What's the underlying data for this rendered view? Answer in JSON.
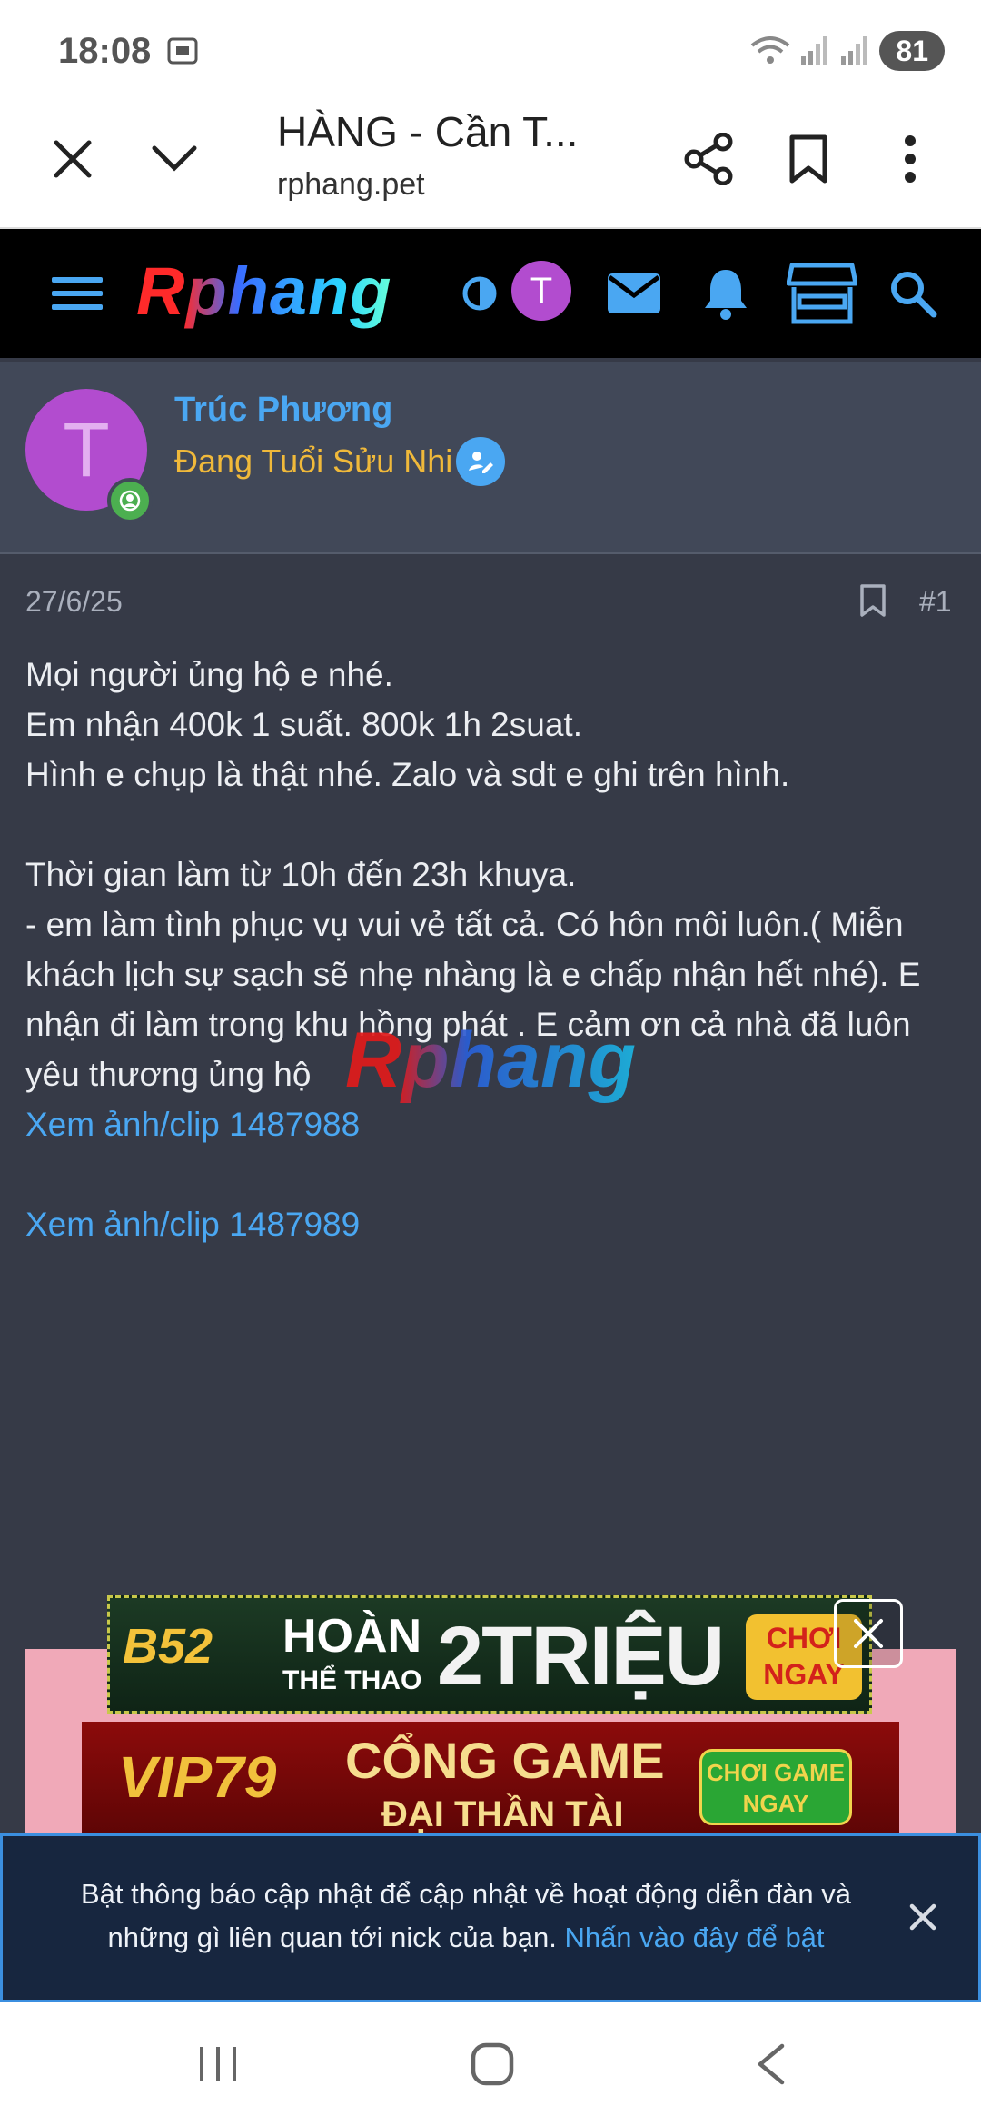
{
  "status_bar": {
    "time": "18:08",
    "battery": "81"
  },
  "browser": {
    "title": "HÀNG - Cần T...",
    "domain": "rphang.pet"
  },
  "site_nav": {
    "logo": "Rphang",
    "avatar_letter": "T"
  },
  "user": {
    "avatar_letter": "T",
    "name": "Trúc Phương",
    "rank": "Đang Tuổi Sửu Nhi"
  },
  "post": {
    "date": "27/6/25",
    "number": "#1",
    "lines": [
      "Mọi người ủng hộ e nhé.",
      "Em nhận 400k 1 suất. 800k 1h 2suat.",
      "Hình e chụp là thật nhé. Zalo và sdt e ghi trên hình.",
      "Thời gian làm từ 10h đến 23h khuya.",
      "- em làm tình phục vụ vui vẻ tất cả. Có hôn môi luôn.( Miễn khách lịch sự sạch sẽ nhẹ nhàng là e chấp nhận hết nhé). E nhận đi làm trong khu hồng phát . E cảm ơn cả nhà đã luôn yêu thương ủng hộ"
    ],
    "link1": "Xem ảnh/clip 1487988",
    "link2": "Xem ảnh/clip 1487989",
    "watermark": "Rphang"
  },
  "ads": {
    "b52": {
      "logo": "B52",
      "line1": "HOÀN",
      "line2": "THỂ THAO",
      "amount": "2TRIỆU",
      "cta": "CHƠI NGAY"
    },
    "vip": {
      "logo": "VIP79",
      "line1": "CỔNG GAME",
      "line2": "ĐẠI THẦN TÀI",
      "cta": "CHƠI GAME NGAY"
    }
  },
  "notification": {
    "text": "Bật thông báo cập nhật để cập nhật về hoạt động diễn đàn và những gì liên quan tới nick của bạn.",
    "link": "Nhấn vào đây để bật"
  },
  "colors": {
    "accent": "#4aa7f2",
    "rank": "#f0b93a",
    "avatar": "#b24ccf",
    "background": "#363a47"
  }
}
